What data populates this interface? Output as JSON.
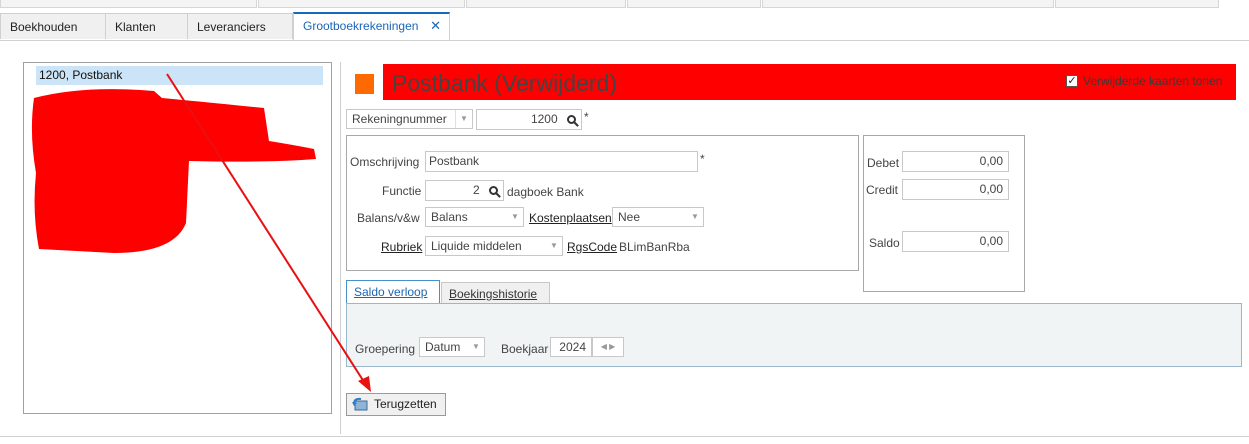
{
  "tabs": [
    {
      "label": "Boekhouden"
    },
    {
      "label": "Klanten"
    },
    {
      "label": "Leveranciers"
    },
    {
      "label": "Grootboekrekeningen",
      "active": true,
      "close": "✕"
    }
  ],
  "list": {
    "selected": "1200, Postbank"
  },
  "header": {
    "title": "Postbank (Verwijderd)",
    "show_deleted_checked": true,
    "show_deleted_label": "Verwijderde kaarten tonen",
    "accent_color": "#ff0000",
    "marker_color": "#ff6a00"
  },
  "account": {
    "type_label": "Rekeningnummer",
    "number": "1200",
    "required": "*"
  },
  "details": {
    "omschrijving_label": "Omschrijving",
    "omschrijving_value": "Postbank",
    "functie_label": "Functie",
    "functie_value": "2",
    "functie_desc": "dagboek Bank",
    "balans_label": "Balans/v&w",
    "balans_value": "Balans",
    "kostenplaatsen_label": "Kostenplaatsen",
    "kostenplaatsen_value": "Nee",
    "rubriek_label": "Rubriek",
    "rubriek_value": "Liquide middelen",
    "rgscode_label": "RgsCode",
    "rgscode_value": "BLimBanRba"
  },
  "totals": {
    "debet_label": "Debet",
    "debet_value": "0,00",
    "credit_label": "Credit",
    "credit_value": "0,00",
    "saldo_label": "Saldo",
    "saldo_value": "0,00"
  },
  "subtabs": [
    {
      "label": "Saldo verloop",
      "active": true
    },
    {
      "label": "Boekingshistorie"
    }
  ],
  "saldo_panel": {
    "groepering_label": "Groepering",
    "groepering_value": "Datum",
    "boekjaar_label": "Boekjaar",
    "boekjaar_value": "2024"
  },
  "actions": {
    "restore_label": "Terugzetten"
  }
}
